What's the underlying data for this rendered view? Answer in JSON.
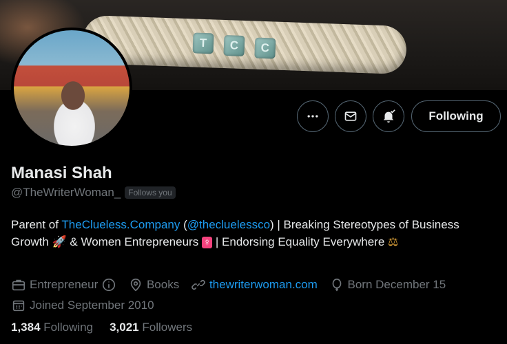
{
  "banner": {
    "bead_letters": [
      "T",
      "C",
      "C"
    ]
  },
  "actions": {
    "more_icon": "more-horizontal-icon",
    "message_icon": "envelope-icon",
    "notify_icon": "bell-check-icon",
    "follow_label": "Following"
  },
  "profile": {
    "display_name": "Manasi Shah",
    "handle": "@TheWriterWoman_",
    "follows_you": "Follows you"
  },
  "bio": {
    "prefix": "Parent of ",
    "link_company": "TheClueless.Company",
    "open_paren": " (",
    "mention": "@thecluelessco",
    "middle": ") | Breaking Stereotypes of Business Growth ",
    "emoji_rocket": "🚀",
    "mid2": " & Women Entrepreneurs ",
    "emoji_female": "♀",
    "suffix": " | Endorsing Equality Everywhere ",
    "emoji_scales": "⚖"
  },
  "meta": {
    "profession": "Entrepreneur",
    "location": "Books",
    "website": "thewriterwoman.com",
    "birthday": "Born December 15",
    "joined": "Joined September 2010"
  },
  "stats": {
    "following_count": "1,384",
    "following_label": "Following",
    "followers_count": "3,021",
    "followers_label": "Followers"
  },
  "colors": {
    "accent": "#1d9bf0",
    "muted": "#71767b",
    "text": "#e7e9ea",
    "background": "#000000"
  }
}
